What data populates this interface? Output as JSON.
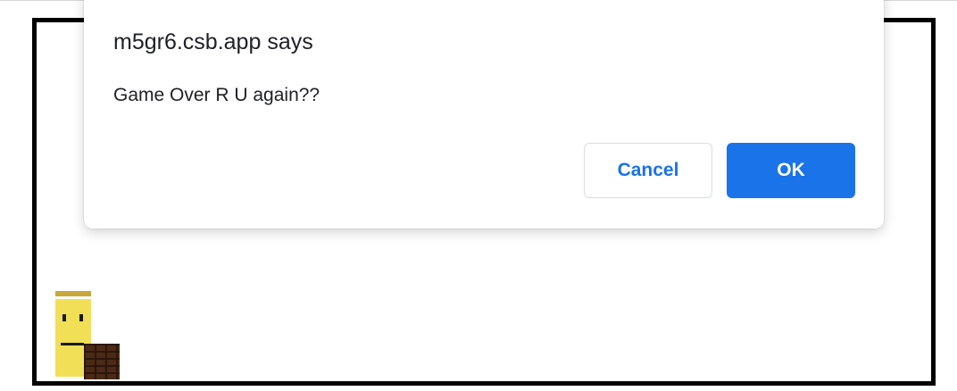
{
  "dialog": {
    "title": "m5gr6.csb.app says",
    "message": "Game Over R U again??",
    "cancel_label": "Cancel",
    "ok_label": "OK"
  },
  "colors": {
    "accent": "#1a73e8",
    "player_body": "#f1df57",
    "player_cap": "#c9a83a",
    "brick": "#4a2a16",
    "frame_border": "#000000"
  },
  "icons": {
    "player": "yellow-block-character-icon",
    "brick": "brick-block-icon"
  }
}
